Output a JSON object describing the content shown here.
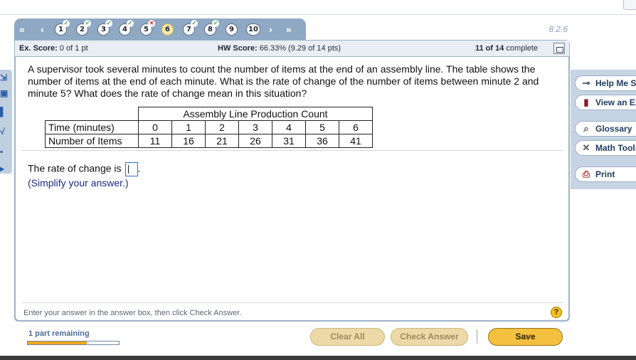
{
  "nav": {
    "first_icon": "double-left-arrow",
    "prev_icon": "left-arrow",
    "next_icon": "right-arrow",
    "last_icon": "double-right-arrow",
    "questions": [
      {
        "num": "1",
        "status": "correct"
      },
      {
        "num": "2",
        "status": "correct"
      },
      {
        "num": "3",
        "status": "correct"
      },
      {
        "num": "4",
        "status": "correct"
      },
      {
        "num": "5",
        "status": "incorrect"
      },
      {
        "num": "6",
        "status": "current"
      },
      {
        "num": "7",
        "status": "correct"
      },
      {
        "num": "8",
        "status": "correct"
      },
      {
        "num": "9",
        "status": "none"
      },
      {
        "num": "10",
        "status": "none"
      }
    ],
    "section": "8.2.6"
  },
  "score": {
    "ex_label": "Ex. Score:",
    "ex_value": "0 of 1 pt",
    "hw_label": "HW Score:",
    "hw_value": "66.33% (9.29 of 14 pts)",
    "progress_bold": "11 of 14",
    "progress_text": "complete"
  },
  "question": {
    "text": "A supervisor took several minutes to count the number of items at the end of an assembly line. The table shows the number of items at the end of each minute. What is the rate of change of the number of items between minute 2 and minute 5? What does the rate of change mean in this situation?",
    "table": {
      "caption": "Assembly Line Production Count",
      "row1_label": "Time (minutes)",
      "row1": [
        "0",
        "1",
        "2",
        "3",
        "4",
        "5",
        "6"
      ],
      "row2_label": "Number of Items",
      "row2": [
        "11",
        "16",
        "21",
        "26",
        "31",
        "36",
        "41"
      ]
    },
    "answer_prefix": "The rate of change is",
    "answer_value": "",
    "answer_suffix": ".",
    "hint": "(Simplify your answer.)",
    "instructions": "Enter your answer in the answer box, then click Check Answer.",
    "help_symbol": "?"
  },
  "side_tools": [
    {
      "label": "Help Me Solve This",
      "icon": "key-icon"
    },
    {
      "label": "View an Example",
      "icon": "book-icon"
    },
    {
      "label": "Glossary",
      "icon": "magnifier-icon"
    },
    {
      "label": "Math Tools",
      "icon": "tools-icon"
    },
    {
      "label": "Print",
      "icon": "printer-icon"
    }
  ],
  "footer": {
    "remaining": "1 part remaining",
    "progress_fraction": 0.65,
    "clear_label": "Clear All",
    "check_label": "Check Answer",
    "save_label": "Save"
  }
}
